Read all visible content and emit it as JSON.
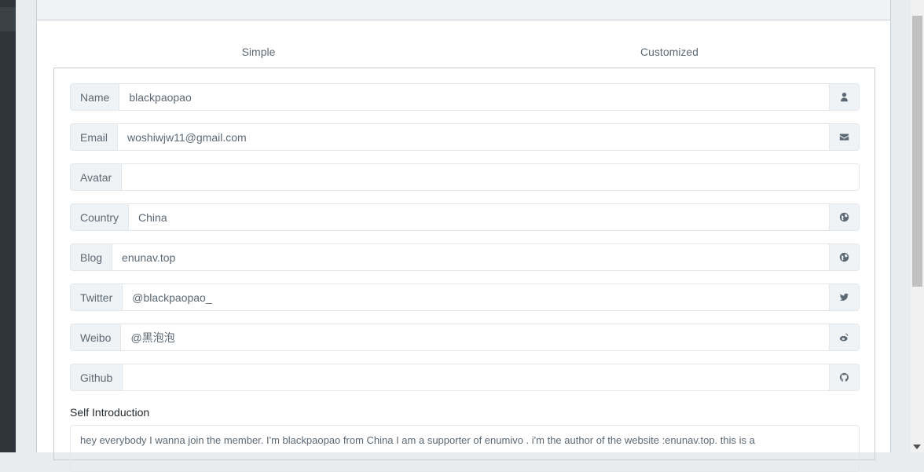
{
  "tabs": {
    "simple": "Simple",
    "customized": "Customized"
  },
  "fields": [
    {
      "label": "Name",
      "value": "blackpaopao",
      "icon": "user-icon"
    },
    {
      "label": "Email",
      "value": "woshiwjw11@gmail.com",
      "icon": "envelope-icon"
    },
    {
      "label": "Avatar",
      "value": "",
      "icon": ""
    },
    {
      "label": "Country",
      "value": "China",
      "icon": "globe-icon"
    },
    {
      "label": "Blog",
      "value": "enunav.top",
      "icon": "globe-icon"
    },
    {
      "label": "Twitter",
      "value": "@blackpaopao_",
      "icon": "twitter-icon"
    },
    {
      "label": "Weibo",
      "value": "@黑泡泡",
      "icon": "weibo-icon"
    },
    {
      "label": "Github",
      "value": "",
      "icon": "github-icon"
    }
  ],
  "self_intro": {
    "label": "Self Introduction",
    "text": "hey everybody  I wanna join the member. I'm blackpaopao from China I am a  supporter of enumivo .  i'm the author of the website :enunav.top.   this is a"
  }
}
